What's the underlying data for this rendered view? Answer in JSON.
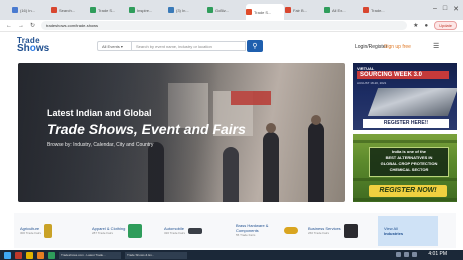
{
  "browser": {
    "tabs": [
      {
        "label": "(16) In...",
        "color": "#4a7bd0"
      },
      {
        "label": "Search...",
        "color": "#d8462f"
      },
      {
        "label": "Trade S...",
        "color": "#2f9d5b"
      },
      {
        "label": "Inspire...",
        "color": "#2f9d5b"
      },
      {
        "label": "(3) In...",
        "color": "#3a7ab8"
      },
      {
        "label": "GoBiz...",
        "color": "#2f9d5b"
      },
      {
        "label": "Trade S...",
        "color": "#e04b2a"
      },
      {
        "label": "Fair B...",
        "color": "#d8462f"
      },
      {
        "label": "Ali Ex...",
        "color": "#2f9d5b"
      },
      {
        "label": "Trade...",
        "color": "#d8462f"
      },
      {
        "label": "Expos...",
        "color": "#2f9d5b"
      }
    ],
    "active_tab_index": 6,
    "url": "tradeshows.com/trade-shows",
    "update_label": "Update"
  },
  "site": {
    "logo_line1": "Trade",
    "logo_line2_a": "Sh",
    "logo_line2_o": "o",
    "logo_line2_b": "ws",
    "search_category": "All Events",
    "search_placeholder": "Search by event name, industry or location",
    "login_label": "Login/Register",
    "signup_label": "Sign up free"
  },
  "hero": {
    "line1": "Latest Indian and Global",
    "line2": "Trade Shows, Event and Fairs",
    "line3": "Browse by: Industry, Calendar, City and Country"
  },
  "ads": {
    "ad1": {
      "kicker": "VIRTUAL",
      "title": "SOURCING WEEK 3.0",
      "date": "AUGUST 18-20, 2021",
      "cta": "REGISTER HERE!!"
    },
    "ad2": {
      "line1": "India is one of the",
      "line2": "BEST ALTERNATIVES IN",
      "line3": "GLOBAL CROP PROTECTION",
      "line4": "CHEMICAL SECTOR",
      "cta": "REGISTER NOW!"
    }
  },
  "categories": [
    {
      "name": "Agriculture",
      "count": "300 Trade Fairs",
      "icon": "plant-icon",
      "color": "#c9a227"
    },
    {
      "name": "Apparel & Clothing",
      "count": "287 Trade Fairs",
      "icon": "apparel-icon",
      "color": "#2f9d5b"
    },
    {
      "name": "Automobile",
      "count": "320 Trade Fairs",
      "icon": "car-icon",
      "color": "#3a3f47"
    },
    {
      "name": "Brass Hardware & Components",
      "count": "55 Trade Fairs",
      "icon": "hardware-icon",
      "color": "#d9a520"
    },
    {
      "name": "Business Services",
      "count": "260 Trade Fairs",
      "icon": "briefcase-icon",
      "color": "#2b2b30"
    }
  ],
  "view_all": {
    "line1": "View All",
    "line2": "Industries"
  },
  "taskbar": {
    "window_label": "Tradeshows.com - Latest Trade...",
    "window_label_2": "Trade Shows & Ev...",
    "time": "4:01 PM"
  }
}
